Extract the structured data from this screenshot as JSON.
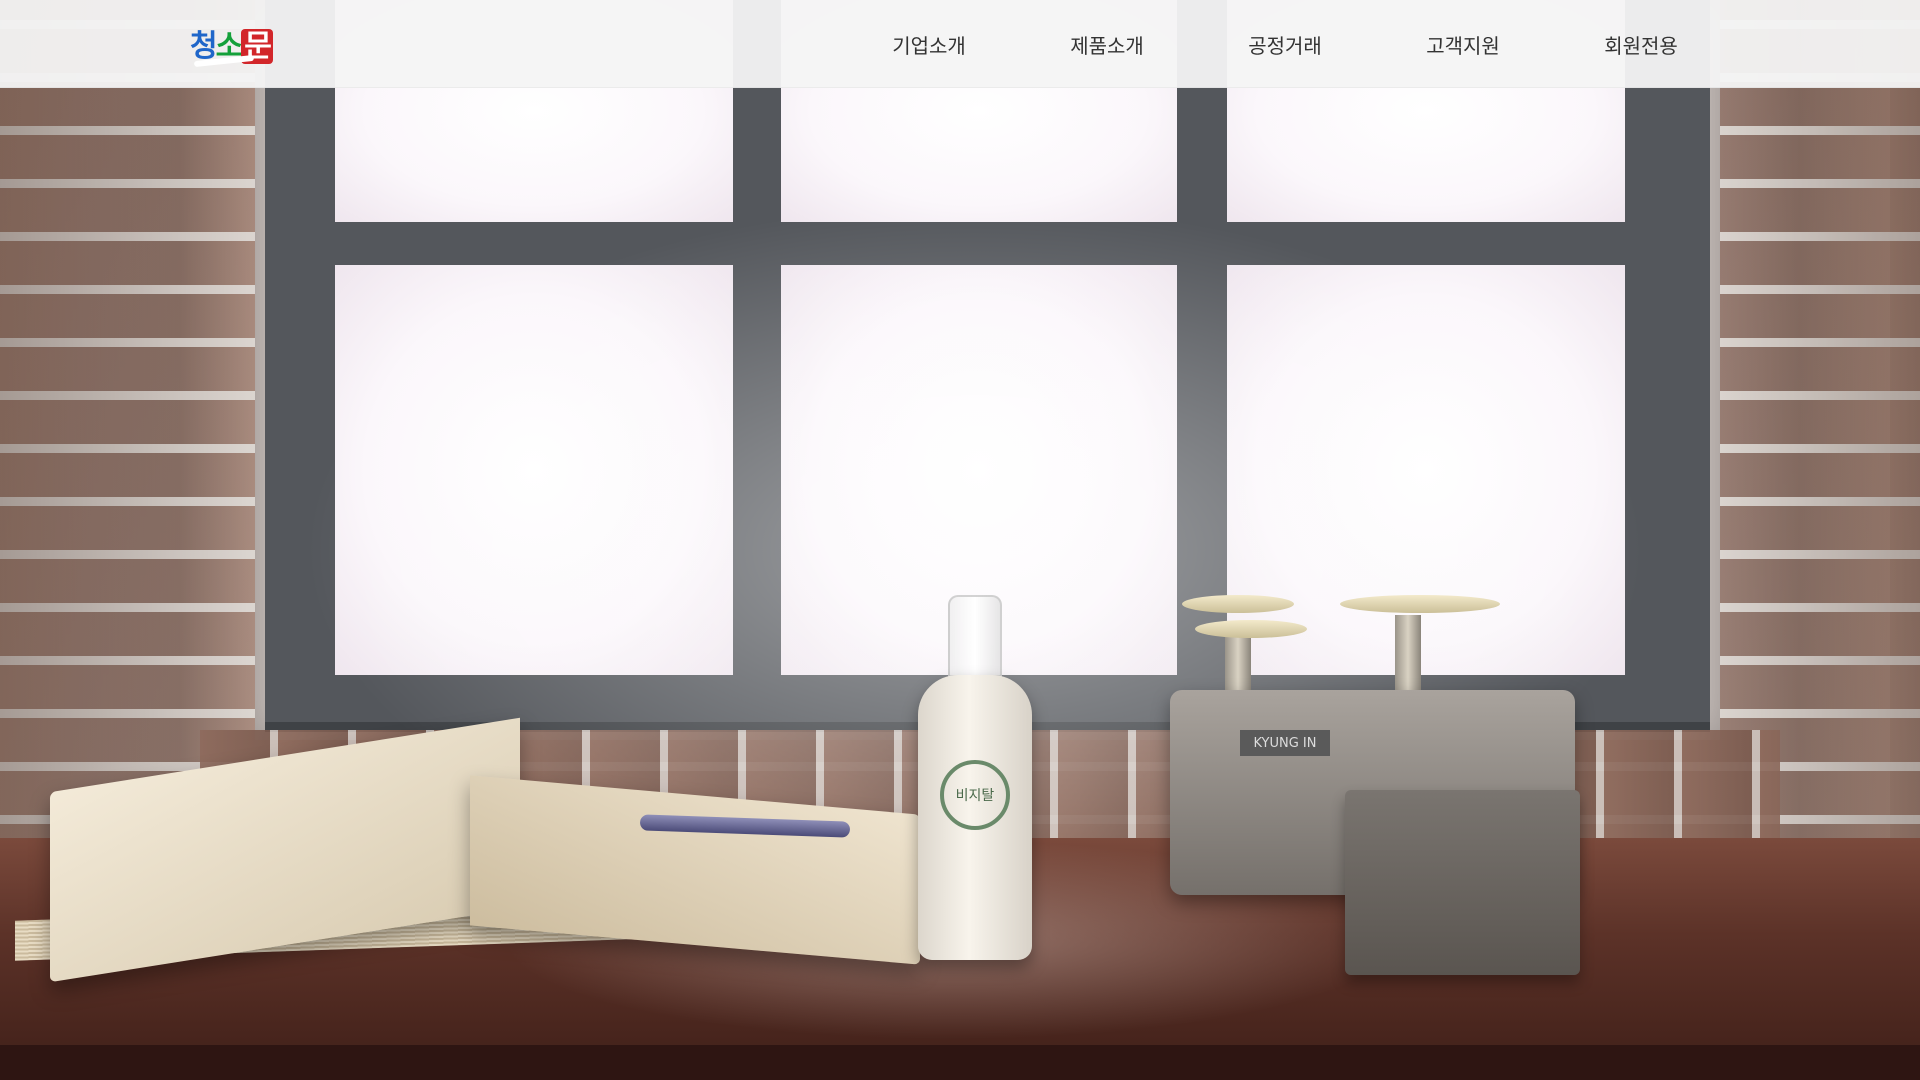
{
  "header": {
    "logo_text": [
      "청",
      "소",
      "문"
    ],
    "nav": [
      {
        "label": "기업소개"
      },
      {
        "label": "제품소개"
      },
      {
        "label": "공정거래"
      },
      {
        "label": "고객지원"
      },
      {
        "label": "회원전용"
      }
    ]
  },
  "hero": {
    "bottle_label": "비지탈",
    "scale_badge": "KYUNG IN"
  },
  "colors": {
    "header_bg": "#f4f4f4",
    "nav_text": "#333333",
    "logo_blue": "#1f66c9",
    "logo_green": "#14a03a",
    "logo_red": "#d2262a"
  }
}
